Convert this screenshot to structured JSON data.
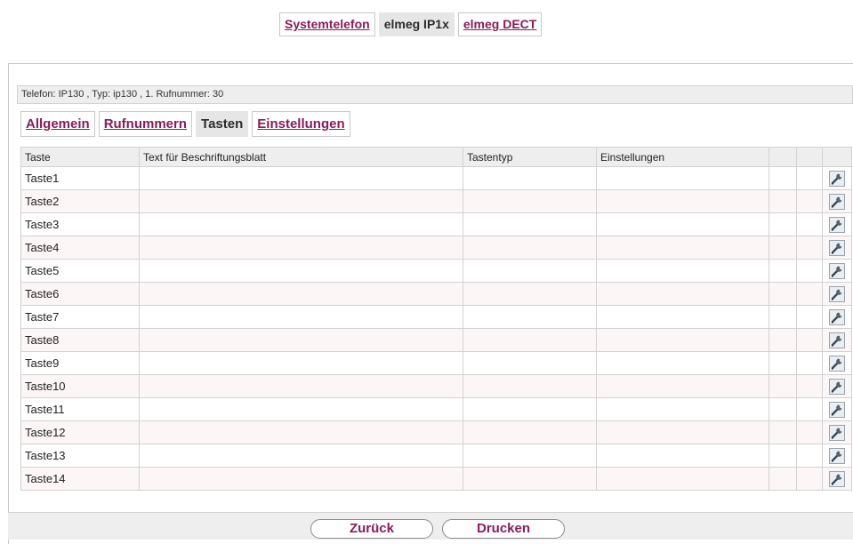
{
  "top_tabs": [
    {
      "label": "Systemtelefon",
      "active": false
    },
    {
      "label": "elmeg IP1x",
      "active": true
    },
    {
      "label": "elmeg DECT",
      "active": false
    }
  ],
  "info_bar": "Telefon: IP130 , Typ: ip130 , 1. Rufnummer: 30",
  "sub_tabs": [
    {
      "label": "Allgemein",
      "active": false
    },
    {
      "label": "Rufnummern",
      "active": false
    },
    {
      "label": "Tasten",
      "active": true
    },
    {
      "label": "Einstellungen",
      "active": false
    }
  ],
  "table": {
    "headers": [
      "Taste",
      "Text für Beschriftungsblatt",
      "Tastentyp",
      "Einstellungen",
      "",
      "",
      ""
    ],
    "rows": [
      "Taste1",
      "Taste2",
      "Taste3",
      "Taste4",
      "Taste5",
      "Taste6",
      "Taste7",
      "Taste8",
      "Taste9",
      "Taste10",
      "Taste11",
      "Taste12",
      "Taste13",
      "Taste14"
    ],
    "row_icon": "wrench-edit-icon"
  },
  "buttons": {
    "back": "Zurück",
    "print": "Drucken"
  },
  "colors": {
    "link": "#8b1a5a",
    "header_bg": "#eeeeee",
    "alt_row_bg": "#fcf6f6"
  }
}
